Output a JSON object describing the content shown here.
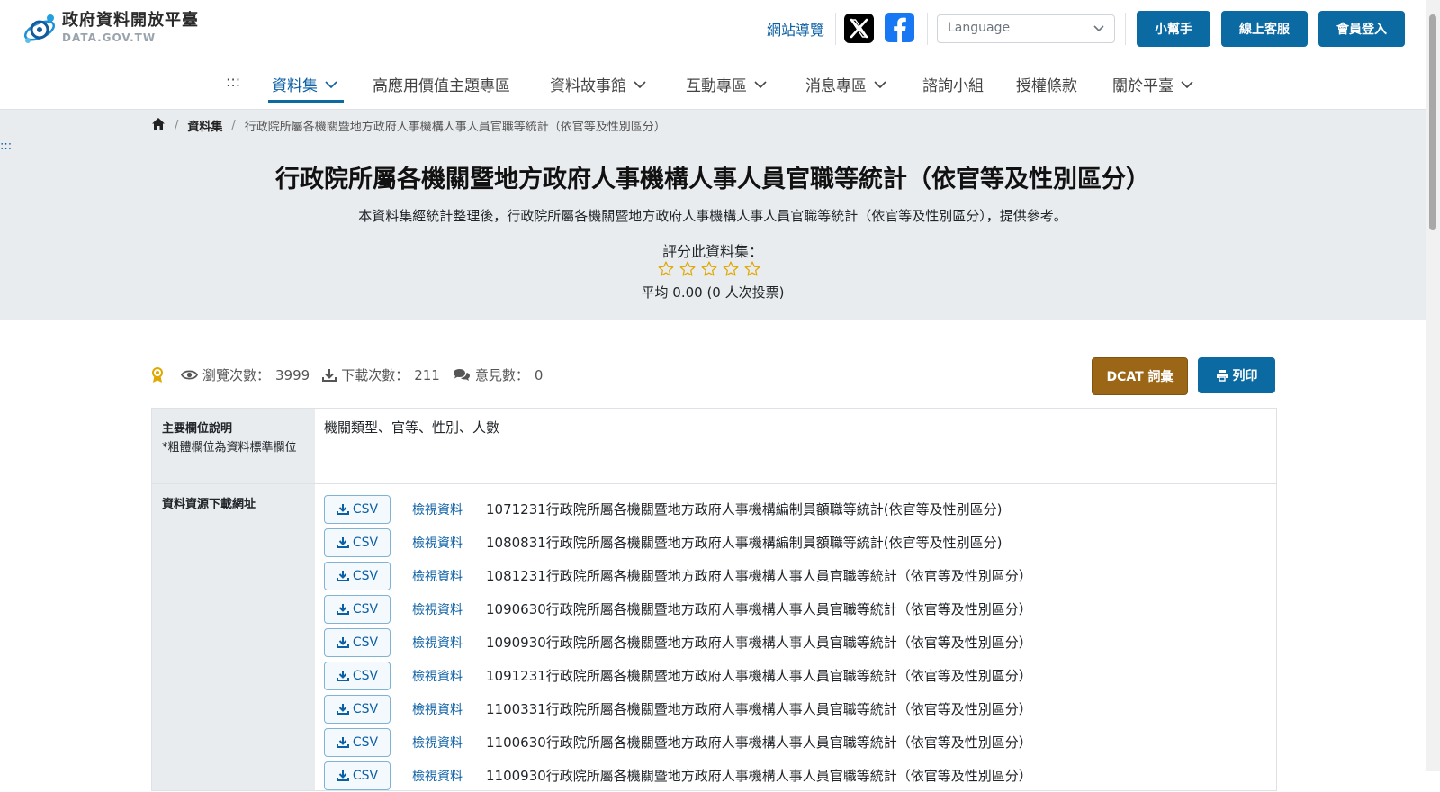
{
  "header": {
    "logo_zh": "政府資料開放平臺",
    "logo_en": "DATA.GOV.TW",
    "sitemap": "網站導覽",
    "language_placeholder": "Language",
    "buttons": [
      "小幫手",
      "線上客服",
      "會員登入"
    ]
  },
  "nav": {
    "dots": ":::",
    "items": [
      {
        "label": "資料集",
        "dropdown": true,
        "active": true
      },
      {
        "label": "高應用價值主題專區",
        "dropdown": false
      },
      {
        "label": "資料故事館",
        "dropdown": true
      },
      {
        "label": "互動專區",
        "dropdown": true
      },
      {
        "label": "消息專區",
        "dropdown": true
      },
      {
        "label": "諮詢小組",
        "dropdown": false
      },
      {
        "label": "授權條款",
        "dropdown": false
      },
      {
        "label": "關於平臺",
        "dropdown": true
      }
    ]
  },
  "side_dots": ":::",
  "breadcrumb": {
    "section": "資料集",
    "current": "行政院所屬各機關暨地方政府人事機構人事人員官職等統計（依官等及性別區分）"
  },
  "hero": {
    "title": "行政院所屬各機關暨地方政府人事機構人事人員官職等統計（依官等及性別區分）",
    "description": "本資料集經統計整理後，行政院所屬各機關暨地方政府人事機構人事人員官職等統計（依官等及性別區分），提供參考。",
    "rate_label": "評分此資料集：",
    "star_count": 5,
    "average": "平均 0.00 (0 人次投票)"
  },
  "stats": {
    "views_label": "瀏覽次數：",
    "views": "3999",
    "downloads_label": "下載次數：",
    "downloads": "211",
    "comments_label": "意見數：",
    "comments": "0"
  },
  "actions": {
    "dcat": "DCAT 詞彙",
    "print": "列印"
  },
  "table": {
    "fields_header": "主要欄位說明",
    "fields_note": "*粗體欄位為資料標準欄位",
    "fields_value": "機關類型、官等、性別、人數",
    "resources_header": "資料資源下載網址",
    "csv_label": "CSV",
    "view_label": "檢視資料",
    "resources": [
      "1071231行政院所屬各機關暨地方政府人事機構編制員額職等統計(依官等及性別區分)",
      "1080831行政院所屬各機關暨地方政府人事機構編制員額職等統計(依官等及性別區分)",
      "1081231行政院所屬各機關暨地方政府人事機構人事人員官職等統計（依官等及性別區分）",
      "1090630行政院所屬各機關暨地方政府人事機構人事人員官職等統計（依官等及性別區分）",
      "1090930行政院所屬各機關暨地方政府人事機構人事人員官職等統計（依官等及性別區分）",
      "1091231行政院所屬各機關暨地方政府人事機構人事人員官職等統計（依官等及性別區分）",
      "1100331行政院所屬各機關暨地方政府人事機構人事人員官職等統計（依官等及性別區分）",
      "1100630行政院所屬各機關暨地方政府人事機構人事人員官職等統計（依官等及性別區分）",
      "1100930行政院所屬各機關暨地方政府人事機構人事人員官職等統計（依官等及性別區分）"
    ]
  },
  "colors": {
    "primary": "#0b6aa2",
    "link": "#0b5fa5",
    "dcat": "#9b6616",
    "star": "#e0a800",
    "hero_bg": "#e9ecef"
  }
}
